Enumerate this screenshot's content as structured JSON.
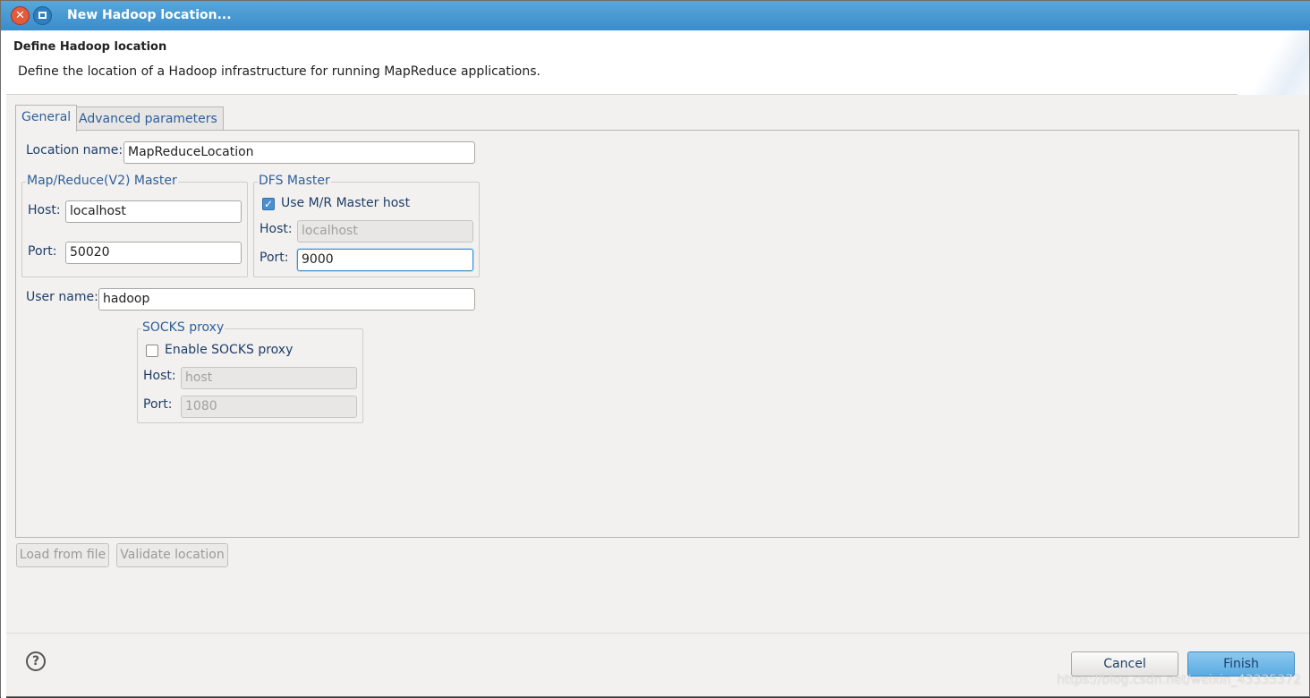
{
  "window": {
    "title": "New Hadoop location..."
  },
  "header": {
    "title": "Define Hadoop location",
    "description": "Define the location of a Hadoop infrastructure for running MapReduce applications."
  },
  "tabs": [
    {
      "label": "General",
      "active": true
    },
    {
      "label": "Advanced parameters",
      "active": false
    }
  ],
  "general": {
    "location_name": {
      "label": "Location name:",
      "value": "MapReduceLocation"
    },
    "mr_master": {
      "title": "Map/Reduce(V2) Master",
      "host_label": "Host:",
      "host_value": "localhost",
      "port_label": "Port:",
      "port_value": "50020"
    },
    "dfs_master": {
      "title": "DFS Master",
      "use_mr_host_label": "Use M/R Master host",
      "use_mr_host_checked": true,
      "host_label": "Host:",
      "host_value": "localhost",
      "port_label": "Port:",
      "port_value": "9000"
    },
    "user_name": {
      "label": "User name:",
      "value": "hadoop"
    },
    "socks": {
      "title": "SOCKS proxy",
      "enable_label": "Enable SOCKS proxy",
      "enable_checked": false,
      "host_label": "Host:",
      "host_value": "host",
      "port_label": "Port:",
      "port_value": "1080"
    }
  },
  "actions": {
    "load_from_file": "Load from file",
    "validate_location": "Validate location"
  },
  "footer": {
    "help": "?",
    "cancel": "Cancel",
    "finish": "Finish"
  },
  "watermark": "https://blog.csdn.net/weixin_43335372",
  "colors": {
    "titlebar": "#3a8ccb",
    "finish_button": "#5aabe1",
    "label_text": "#1f3d66"
  },
  "icons": [
    "close-icon",
    "maximize-icon",
    "help-icon",
    "checkbox-checked-icon",
    "checkbox-unchecked-icon"
  ]
}
